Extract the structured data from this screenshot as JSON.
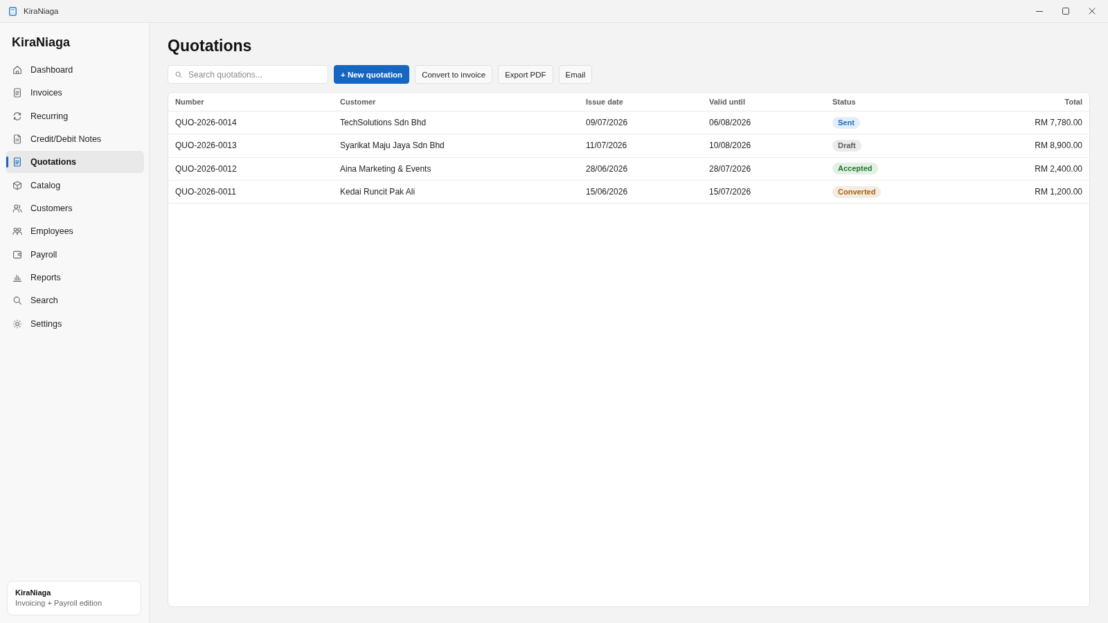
{
  "window": {
    "title": "KiraNiaga"
  },
  "sidebar": {
    "brand": "KiraNiaga",
    "items": [
      {
        "label": "Dashboard",
        "selected": false
      },
      {
        "label": "Invoices",
        "selected": false
      },
      {
        "label": "Recurring",
        "selected": false
      },
      {
        "label": "Credit/Debit Notes",
        "selected": false
      },
      {
        "label": "Quotations",
        "selected": true
      },
      {
        "label": "Catalog",
        "selected": false
      },
      {
        "label": "Customers",
        "selected": false
      },
      {
        "label": "Employees",
        "selected": false
      },
      {
        "label": "Payroll",
        "selected": false
      },
      {
        "label": "Reports",
        "selected": false
      },
      {
        "label": "Search",
        "selected": false
      },
      {
        "label": "Settings",
        "selected": false
      }
    ],
    "footer": {
      "title": "KiraNiaga",
      "subtitle": "Invoicing + Payroll edition"
    }
  },
  "page": {
    "title": "Quotations"
  },
  "toolbar": {
    "search": {
      "placeholder": "Search quotations..."
    },
    "buttons": [
      {
        "label": "+ New quotation",
        "kind": "primary"
      },
      {
        "label": "Convert to invoice",
        "kind": "secondary"
      },
      {
        "label": "Export PDF",
        "kind": "secondary"
      },
      {
        "label": "Email",
        "kind": "secondary"
      }
    ]
  },
  "table": {
    "columns": [
      "Number",
      "Customer",
      "Issue date",
      "Valid until",
      "Status",
      "Total"
    ],
    "rows": [
      {
        "number": "QUO-2026-0014",
        "customer": "TechSolutions Sdn Bhd",
        "issue_date": "09/07/2026",
        "valid_until": "06/08/2026",
        "status": {
          "label": "Sent",
          "color": "#1c6fc4"
        },
        "total": "RM 7,780.00"
      },
      {
        "number": "QUO-2026-0013",
        "customer": "Syarikat Maju Jaya Sdn Bhd",
        "issue_date": "11/07/2026",
        "valid_until": "10/08/2026",
        "status": {
          "label": "Draft",
          "color": "#5c5c5c"
        },
        "total": "RM 8,900.00"
      },
      {
        "number": "QUO-2026-0012",
        "customer": "Aina Marketing & Events",
        "issue_date": "28/06/2026",
        "valid_until": "28/07/2026",
        "status": {
          "label": "Accepted",
          "color": "#1f7a2c"
        },
        "total": "RM 2,400.00"
      },
      {
        "number": "QUO-2026-0011",
        "customer": "Kedai Runcit Pak Ali",
        "issue_date": "15/06/2026",
        "valid_until": "15/07/2026",
        "status": {
          "label": "Converted",
          "color": "#a3620e"
        },
        "total": "RM 1,200.00"
      }
    ]
  }
}
